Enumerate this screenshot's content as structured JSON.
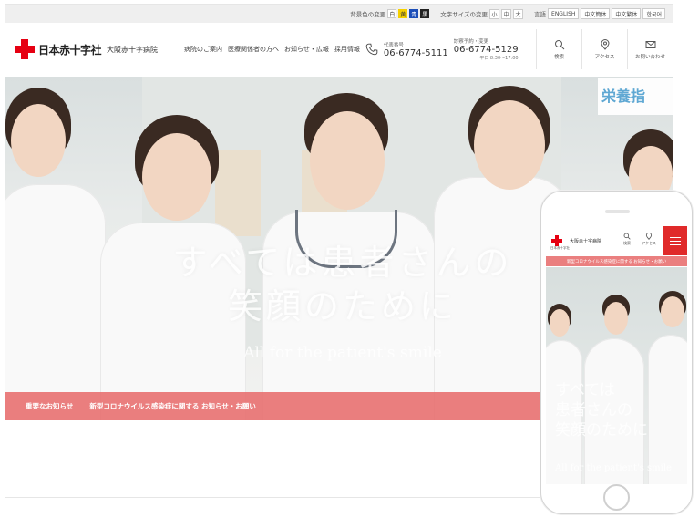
{
  "utility": {
    "color_label": "背景色の変更",
    "color_options": [
      "白",
      "黄",
      "青",
      "黒"
    ],
    "size_label": "文字サイズの変更",
    "size_options": [
      "小",
      "中",
      "大"
    ],
    "lang_label": "言語",
    "languages": [
      "ENGLISH",
      "中文簡体",
      "中文繁体",
      "한국어"
    ]
  },
  "header": {
    "org_name": "日本赤十字社",
    "hospital_name": "大阪赤十字病院",
    "nav": [
      "病院のご案内",
      "医療関係者の方へ",
      "お知らせ・広報",
      "採用情報"
    ],
    "tel_main_label": "代表番号",
    "tel_main": "06-6774-5111",
    "tel_reserve_label": "診察予約・変更",
    "tel_reserve": "06-6774-5129",
    "tel_hours": "平日 8:30〜17:00",
    "icons": [
      {
        "label": "検索",
        "icon": "search-icon"
      },
      {
        "label": "アクセス",
        "icon": "map-pin-icon"
      },
      {
        "label": "お問い合わせ",
        "icon": "mail-icon"
      }
    ]
  },
  "hero": {
    "tagline_line1": "すべては患者さんの",
    "tagline_line2": "笑顔のために",
    "tagline_en": "All for the patient's smile",
    "sign_text": "栄養指"
  },
  "notice": {
    "label": "重要なお知らせ",
    "text": "新型コロナウイルス感染症に関する お知らせ・お願い"
  },
  "mobile": {
    "org_name": "日本赤十字社",
    "hospital_name": "大阪赤十字病院",
    "icon_search": "検索",
    "icon_access": "アクセス",
    "notice": "新型コロナウイルス感染症に関する お知らせ・お願い",
    "tagline_line1": "すべては",
    "tagline_line2": "患者さんの",
    "tagline_line3": "笑顔のために",
    "tagline_en": "All for the patient's smile"
  },
  "colors": {
    "brand_red": "#e60012",
    "notice_bg": "#e86868"
  }
}
